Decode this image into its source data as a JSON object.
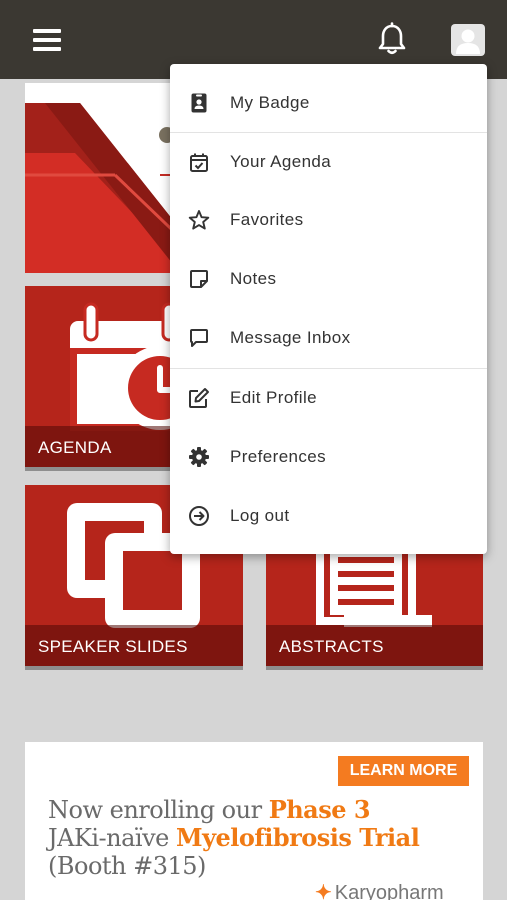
{
  "menu": {
    "items": [
      {
        "label": "My Badge",
        "icon": "badge-icon"
      },
      {
        "label": "Your Agenda",
        "icon": "calendar-check-icon"
      },
      {
        "label": "Favorites",
        "icon": "star-icon"
      },
      {
        "label": "Notes",
        "icon": "note-icon"
      },
      {
        "label": "Message Inbox",
        "icon": "message-icon"
      },
      {
        "label": "Edit Profile",
        "icon": "edit-icon"
      },
      {
        "label": "Preferences",
        "icon": "gear-icon"
      },
      {
        "label": "Log out",
        "icon": "logout-icon"
      }
    ]
  },
  "tiles": [
    {
      "label": "AGENDA",
      "icon": "calendar-clock-icon"
    },
    {
      "label": "SPEAKER SLIDES",
      "icon": "slides-icon"
    },
    {
      "label": "ABSTRACTS",
      "icon": "documents-icon"
    }
  ],
  "ad": {
    "button": "LEARN MORE",
    "line1_plain": "Now enrolling our ",
    "line1_highlight": "Phase 3",
    "line2_plain": "JAKi-naïve ",
    "line2_highlight": "Myelofibrosis Trial",
    "line3": "(Booth #315)",
    "sponsor": "Karyopharm"
  },
  "colors": {
    "topbar": "#3b3832",
    "tile_red": "#b5251b",
    "accent_orange": "#f47b20"
  }
}
